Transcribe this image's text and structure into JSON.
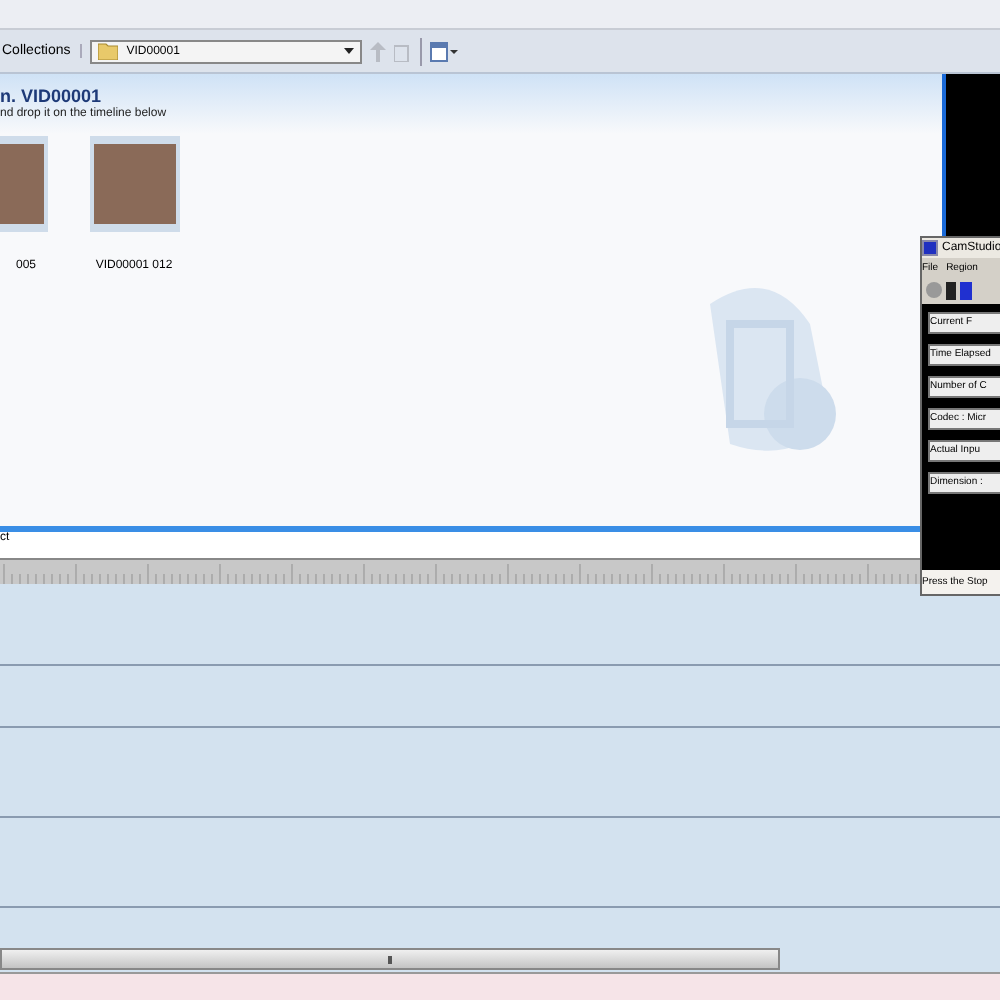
{
  "toolbar": {
    "collections_label": "Collections",
    "dropdown_value": "VID00001"
  },
  "content": {
    "heading": "n. VID00001",
    "hint": "nd drop it on the timeline below",
    "clips": [
      {
        "label": "005"
      },
      {
        "label": "VID00001 012"
      }
    ]
  },
  "strip_label": "ct",
  "camstudio": {
    "title": "CamStudio",
    "menu": [
      "File",
      "Region"
    ],
    "rows": [
      "Current F",
      "Time Elapsed",
      "Number of C",
      "Codec : Micr",
      "Actual Inpu",
      "Dimension : "
    ],
    "status": "Press the Stop"
  }
}
